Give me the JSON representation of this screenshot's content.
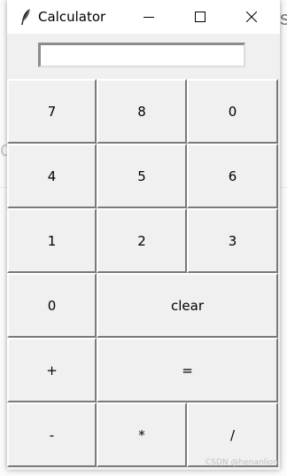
{
  "window": {
    "title": "Calculator",
    "app_icon": "feather-icon"
  },
  "display": {
    "value": ""
  },
  "keys": {
    "k7": "7",
    "k8": "8",
    "k0_top": "0",
    "k4": "4",
    "k5": "5",
    "k6": "6",
    "k1": "1",
    "k2": "2",
    "k3": "3",
    "k0": "0",
    "clear": "clear",
    "plus": "+",
    "equals": "=",
    "minus": "-",
    "multiply": "*",
    "divide": "/"
  },
  "watermark": "CSDN @henanlion",
  "background": {
    "fragment_left": "c",
    "fragment_right": "s"
  }
}
